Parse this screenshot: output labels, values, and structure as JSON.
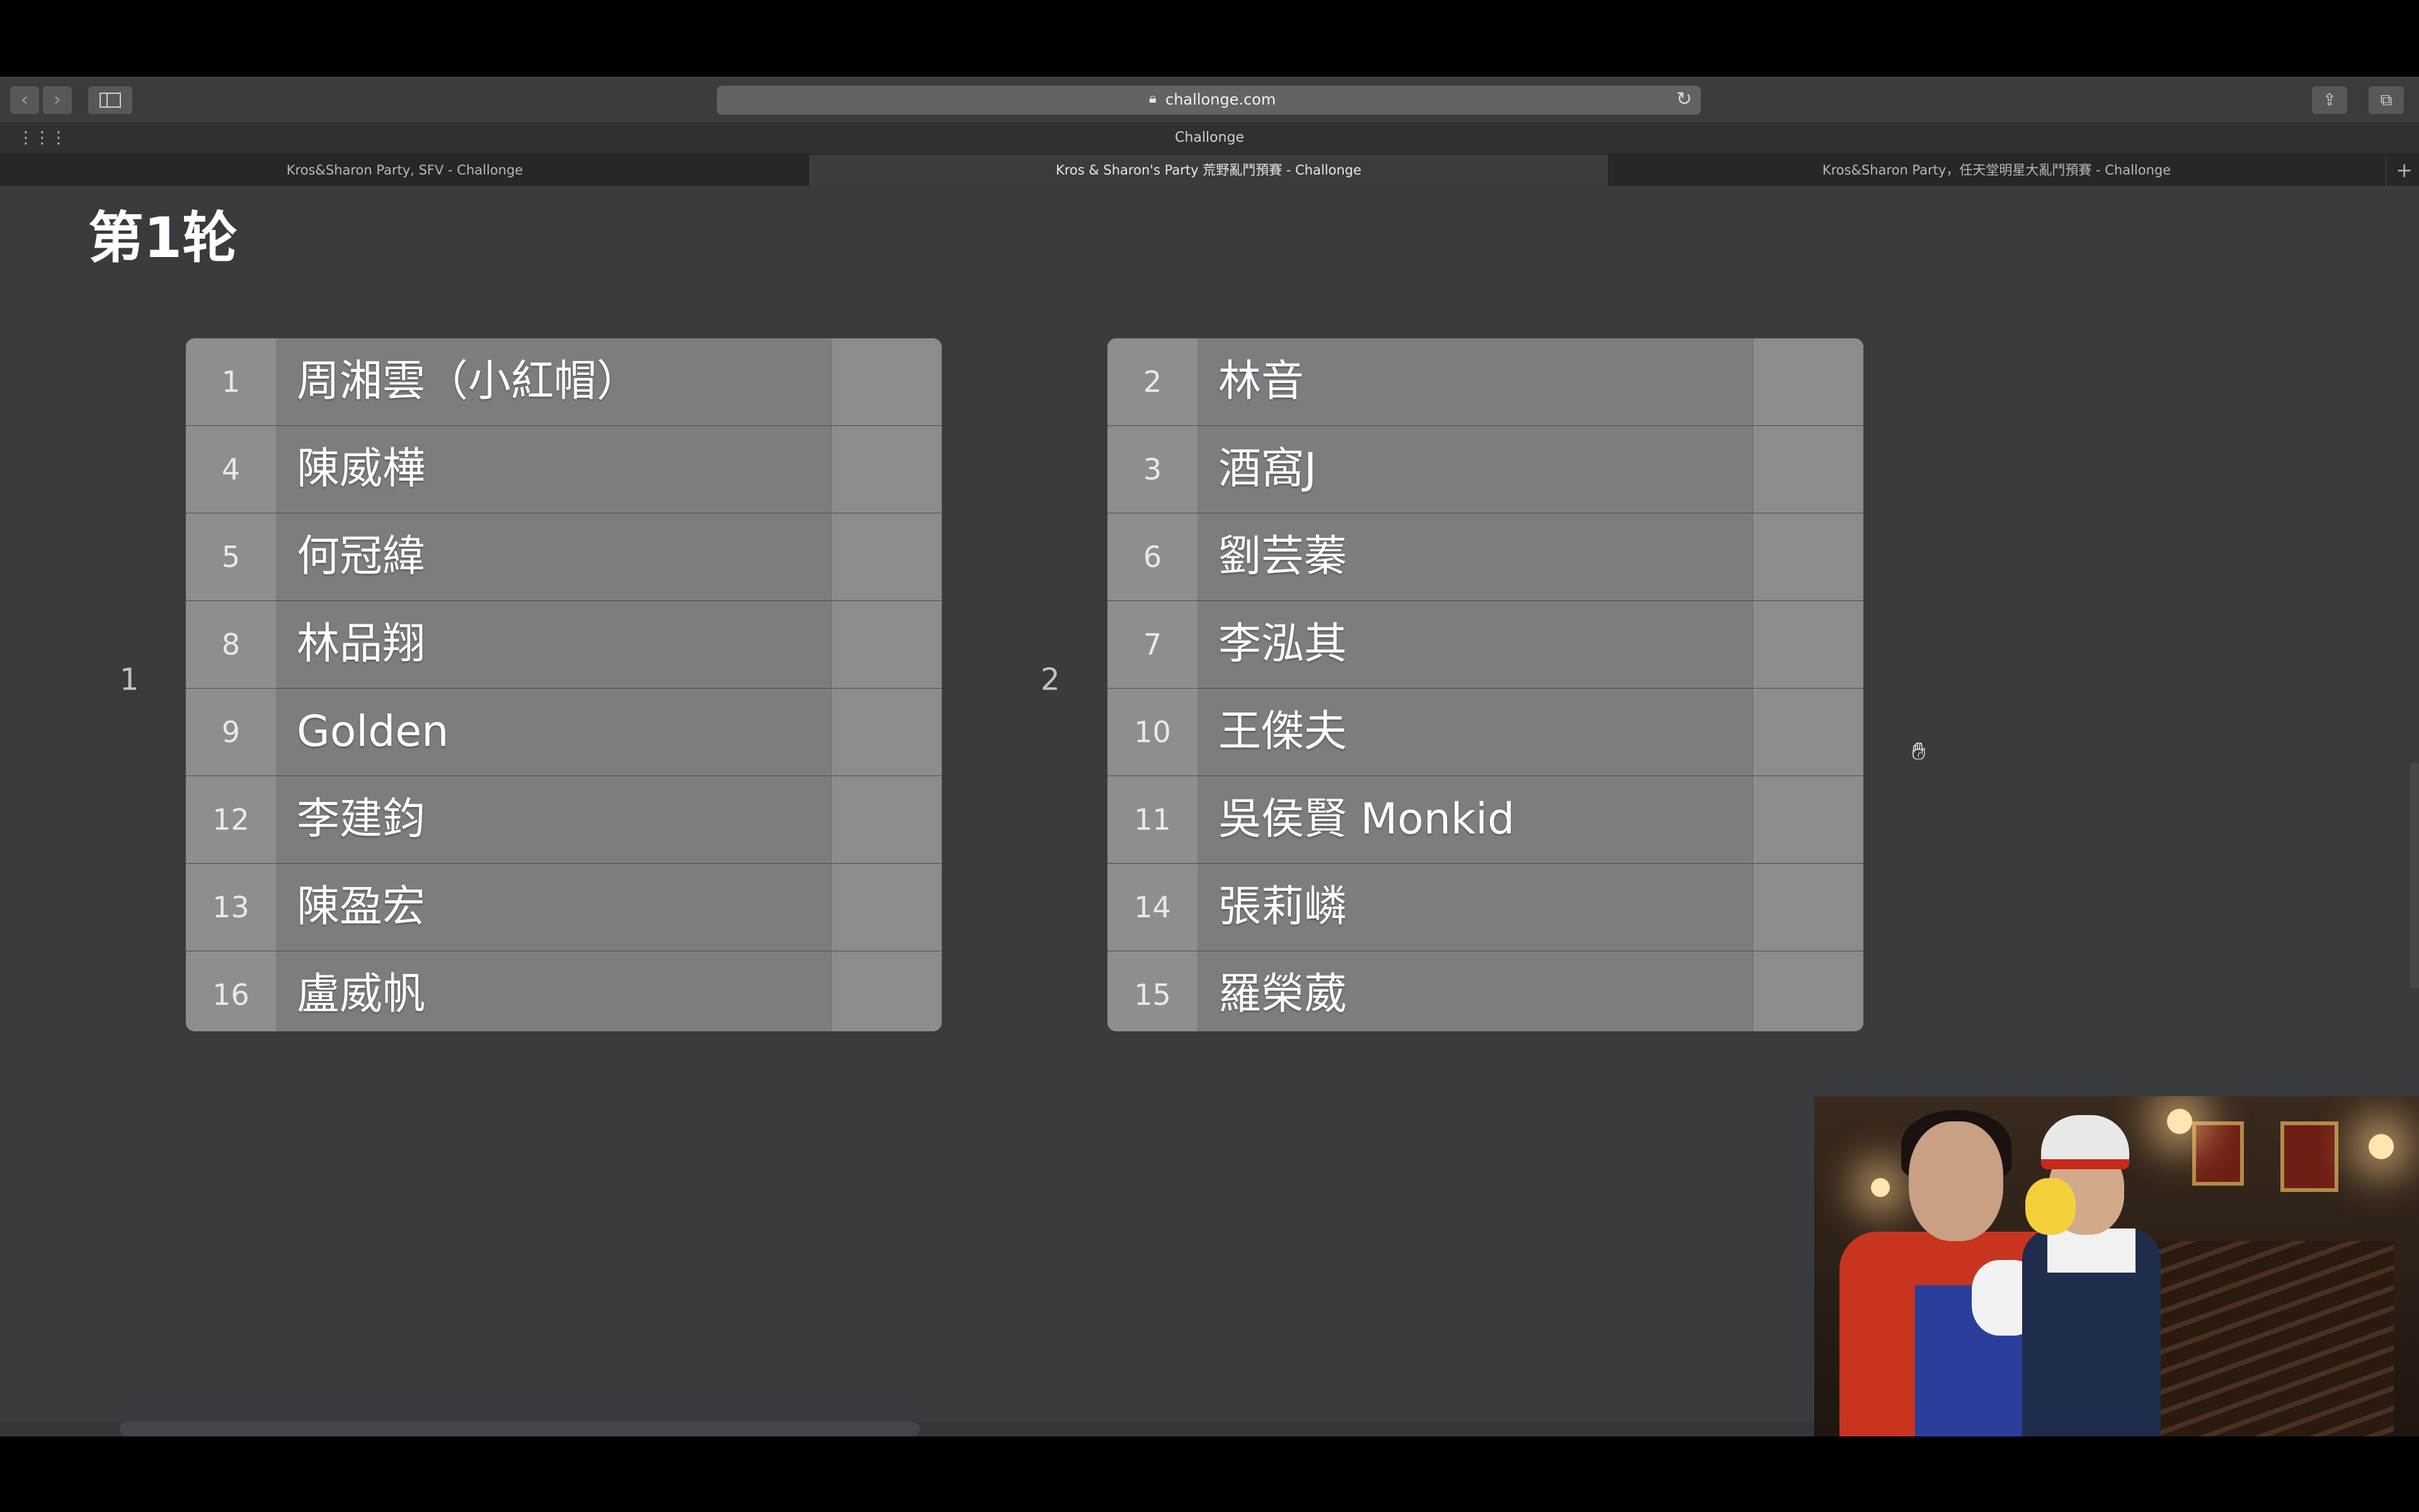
{
  "browser": {
    "url": "challonge.com",
    "favorites_title": "Challonge",
    "tabs": [
      {
        "title": "Kros&Sharon Party, SFV - Challonge",
        "active": false
      },
      {
        "title": "Kros & Sharon's Party 荒野亂鬥預賽 - Challonge",
        "active": true
      },
      {
        "title": "Kros&Sharon Party，任天堂明星大亂鬥預賽 - Challonge",
        "active": false
      }
    ],
    "icons": {
      "back": "chevron-left-icon",
      "forward": "chevron-right-icon",
      "sidebar": "sidebar-icon",
      "lock": "lock-icon",
      "reload": "reload-icon",
      "share": "share-icon",
      "tabs_overview": "tabs-overview-icon",
      "grid": "grid-icon",
      "new_tab": "plus-icon"
    }
  },
  "page": {
    "round_title": "第1轮",
    "groups": [
      {
        "label": "1",
        "players": [
          {
            "seed": "1",
            "name": "周湘雲（小紅帽）"
          },
          {
            "seed": "4",
            "name": "陳威樺"
          },
          {
            "seed": "5",
            "name": "何冠緯"
          },
          {
            "seed": "8",
            "name": "林品翔"
          },
          {
            "seed": "9",
            "name": "Golden"
          },
          {
            "seed": "12",
            "name": "李建鈞"
          },
          {
            "seed": "13",
            "name": "陳盈宏"
          },
          {
            "seed": "16",
            "name": "盧威帆"
          }
        ]
      },
      {
        "label": "2",
        "players": [
          {
            "seed": "2",
            "name": "林音"
          },
          {
            "seed": "3",
            "name": "酒窩J"
          },
          {
            "seed": "6",
            "name": "劉芸蓁"
          },
          {
            "seed": "7",
            "name": "李泓其"
          },
          {
            "seed": "10",
            "name": "王傑夫"
          },
          {
            "seed": "11",
            "name": "吳侯賢 Monkid"
          },
          {
            "seed": "14",
            "name": "張莉嶙"
          },
          {
            "seed": "15",
            "name": "羅榮葳"
          }
        ]
      }
    ]
  },
  "colors": {
    "page_bg": "#393c3f",
    "row_bg": "#7b7e80",
    "seed_bg": "#8c8f91",
    "toolbar_bg": "#3b3c3f"
  }
}
